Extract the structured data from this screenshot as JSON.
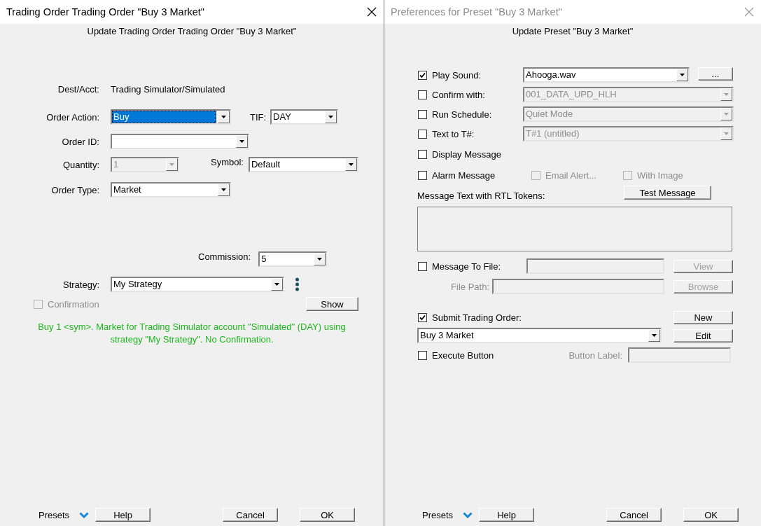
{
  "order_dialog": {
    "title": "Trading Order Trading Order \"Buy 3 Market\"",
    "active": true,
    "subtitle": "Update Trading Order Trading Order \"Buy 3 Market\"",
    "dest_acct": {
      "label": "Dest/Acct:",
      "value": "Trading Simulator/Simulated"
    },
    "order_action": {
      "label": "Order Action:",
      "value": "Buy",
      "focused": true
    },
    "tif": {
      "label": "TIF:",
      "value": "DAY"
    },
    "order_id": {
      "label": "Order ID:"
    },
    "quantity": {
      "label": "Quantity:",
      "value": "1",
      "disabled": true
    },
    "symbol": {
      "label": "Symbol:",
      "value": "Default"
    },
    "order_type": {
      "label": "Order Type:",
      "value": "Market"
    },
    "commission": {
      "label": "Commission:",
      "value": "5"
    },
    "strategy": {
      "label": "Strategy:",
      "value": "My Strategy"
    },
    "confirmation": {
      "label": "Confirmation",
      "checked": false,
      "disabled": true
    },
    "show_button": "Show",
    "summary": "Buy 1 <sym>. Market for Trading Simulator account \"Simulated\" (DAY) using strategy \"My Strategy\". No Confirmation.",
    "footer": {
      "presets": "Presets",
      "buttons": [
        "Help",
        "Cancel",
        "OK"
      ]
    }
  },
  "preset_dialog": {
    "title": "Preferences for Preset \"Buy 3 Market\"",
    "active": false,
    "subtitle": "Update Preset \"Buy 3 Market\"",
    "play_sound": {
      "label": "Play Sound:",
      "checked": true,
      "value": "Ahooga.wav",
      "browse_button": "..."
    },
    "options": [
      {
        "label": "Confirm with:",
        "checked": false,
        "value": "001_DATA_UPD_HLH",
        "disabled": true
      },
      {
        "label": "Run Schedule:",
        "checked": false,
        "value": "Quiet Mode",
        "disabled": true
      },
      {
        "label": "Text to T#:",
        "checked": false,
        "value": "T#1 (untitled)",
        "disabled": true
      }
    ],
    "display_message": {
      "label": "Display Message",
      "checked": false
    },
    "alarm_message": {
      "label": "Alarm Message",
      "checked": false
    },
    "email_alert": {
      "label": "Email Alert...",
      "checked": false,
      "disabled": true
    },
    "with_image": {
      "label": "With Image",
      "checked": false,
      "disabled": true
    },
    "message_text": {
      "label": "Message Text with RTL Tokens:",
      "test_button": "Test Message"
    },
    "message_to_file": {
      "label": "Message To File:",
      "checked": false,
      "field_disabled": true,
      "view_button": {
        "label": "View",
        "disabled": true
      }
    },
    "file_path": {
      "label": "File Path:",
      "disabled": true,
      "browse_button": {
        "label": "Browse",
        "disabled": true
      }
    },
    "submit_order": {
      "label": "Submit Trading Order:",
      "checked": true,
      "value": "Buy 3 Market",
      "new_button": "New",
      "edit_button": "Edit"
    },
    "execute_button": {
      "label": "Execute Button",
      "checked": false,
      "button_label": {
        "label": "Button Label:",
        "disabled": true
      }
    },
    "footer": {
      "presets": "Presets",
      "buttons": [
        "Help",
        "Cancel",
        "OK"
      ]
    }
  }
}
